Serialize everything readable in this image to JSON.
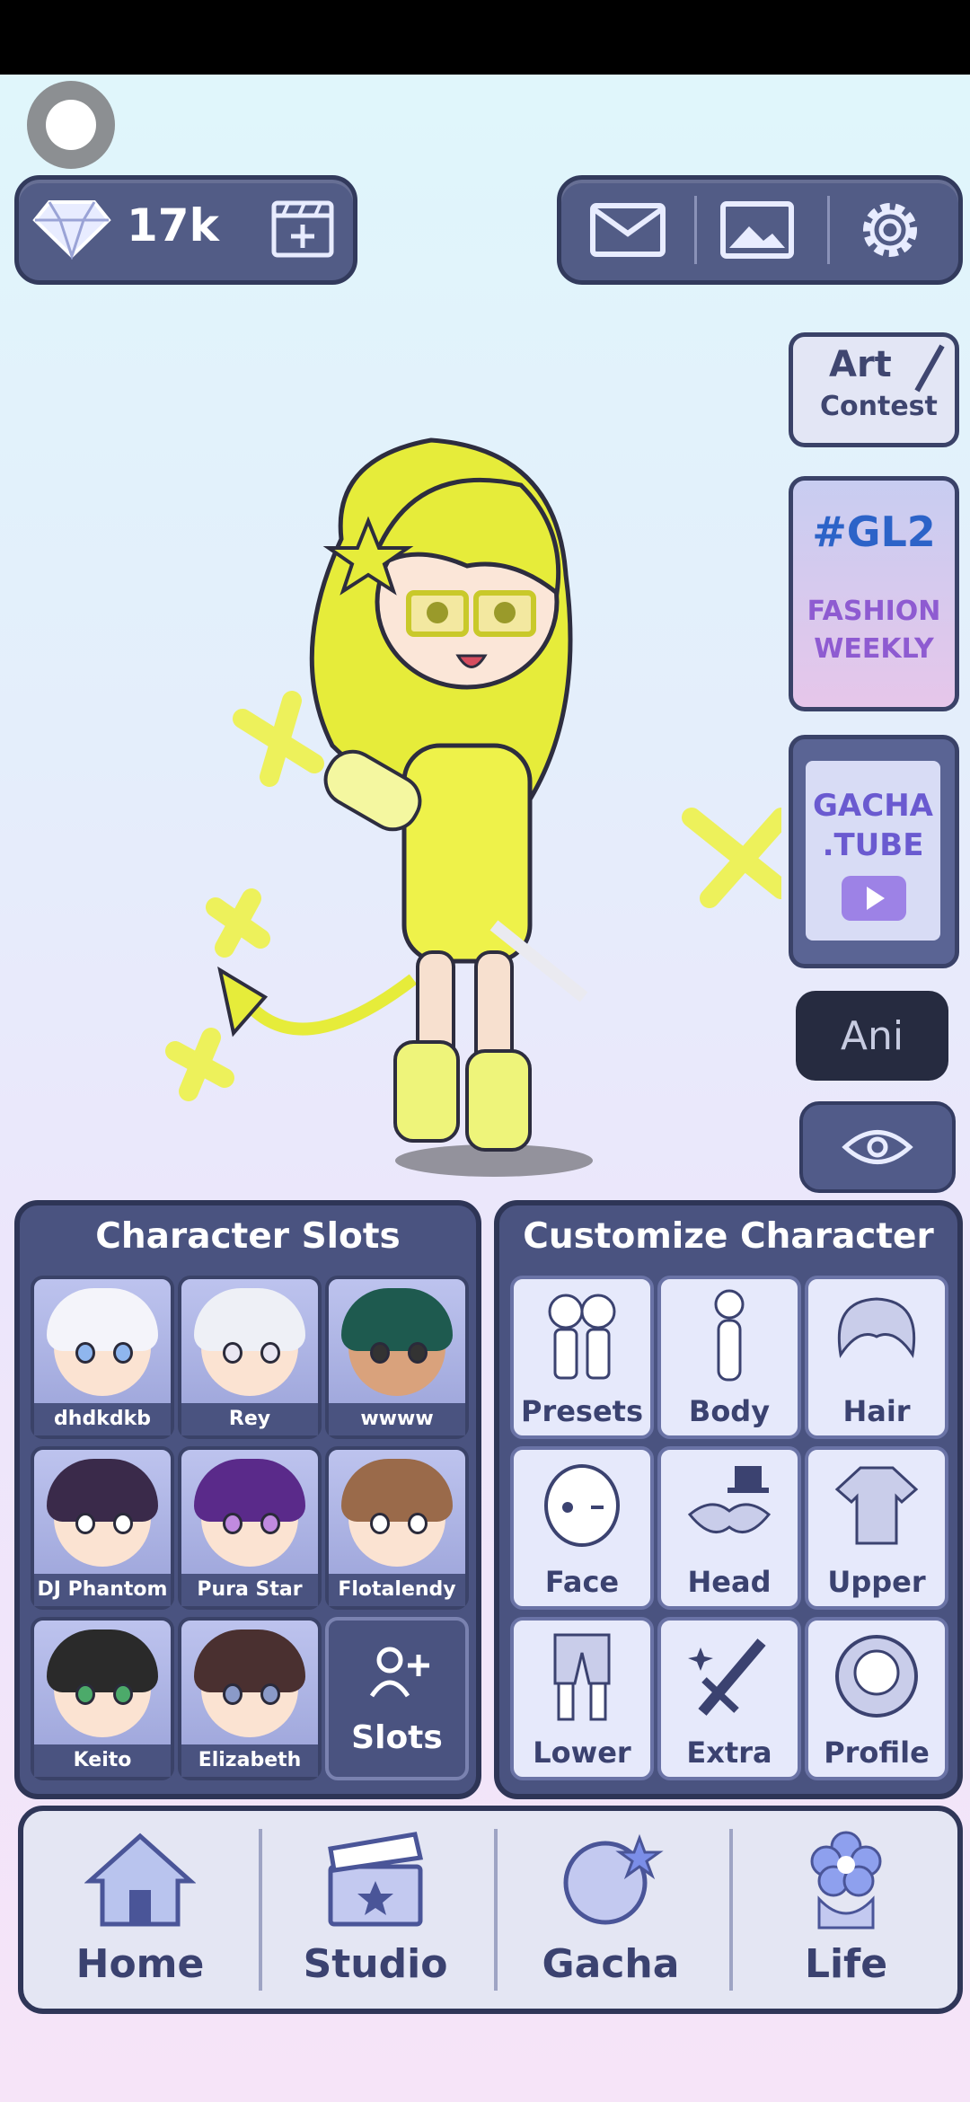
{
  "currency": {
    "count": "17k",
    "icon": "diamond-icon",
    "add_icon": "film-add-icon"
  },
  "top_actions": [
    {
      "name": "mail",
      "icon": "mail-icon"
    },
    {
      "name": "gallery",
      "icon": "image-icon"
    },
    {
      "name": "settings",
      "icon": "gear-icon"
    }
  ],
  "side": {
    "art_contest": {
      "line1": "Art",
      "line2": "Contest"
    },
    "magazine": {
      "headline": "#GL2",
      "line1": "FASHION",
      "line2": "WEEKLY"
    },
    "gacha_tube": {
      "line1": "GACHA",
      "line2": ".TUBE"
    },
    "ani_label": "Ani"
  },
  "character_slots": {
    "title": "Character Slots",
    "slots": [
      "dhdkdkb",
      "Rey",
      "wwww",
      "DJ Phantom",
      "Pura Star",
      "Flotalendy",
      "Keito",
      "Elizabeth"
    ],
    "add_label": "Slots"
  },
  "customize": {
    "title": "Customize Character",
    "items": [
      "Presets",
      "Body",
      "Hair",
      "Face",
      "Head",
      "Upper",
      "Lower",
      "Extra",
      "Profile"
    ]
  },
  "nav": [
    "Home",
    "Studio",
    "Gacha",
    "Life"
  ],
  "colors": {
    "panel": "#4a5380",
    "accent": "#eef24a",
    "text_dark": "#3b4270"
  }
}
